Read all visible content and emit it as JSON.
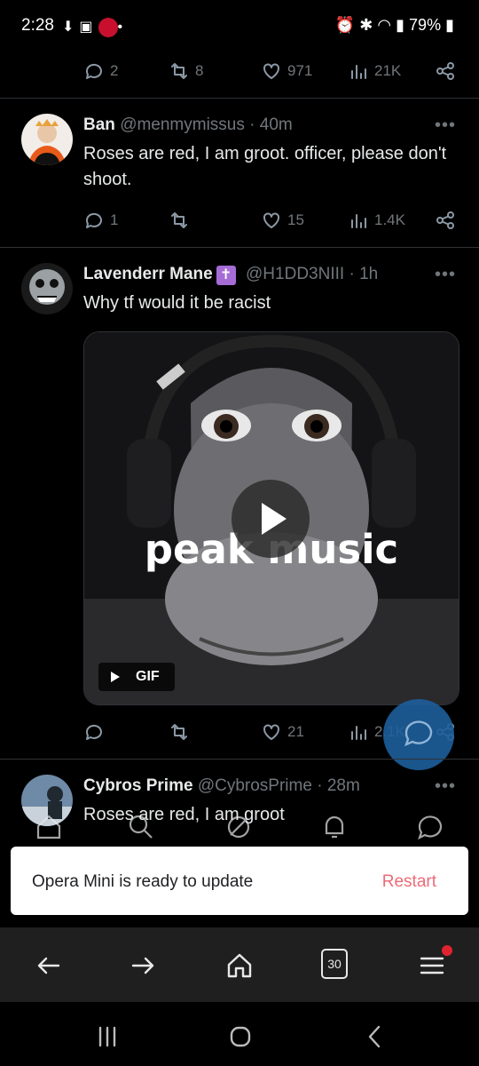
{
  "status_bar": {
    "time": "2:28",
    "battery": "79%"
  },
  "tweet0": {
    "replies": "2",
    "retweets": "8",
    "likes": "971",
    "views": "21K"
  },
  "tweet1": {
    "name": "Ban",
    "handle": "@menmymissus",
    "time": "40m",
    "text": "Roses are red, I am groot. officer, please don't shoot.",
    "replies": "1",
    "retweets": "",
    "likes": "15",
    "views": "1.4K"
  },
  "tweet2": {
    "name": "Lavenderr Mane",
    "badge": "✝",
    "handle": "@H1DD3NIII",
    "time": "1h",
    "text": "Why tf would it be racist",
    "media_caption": "peak music",
    "media_label": "GIF",
    "replies": "",
    "retweets": "",
    "likes": "21",
    "views": "2.1K"
  },
  "tweet3": {
    "name": "Cybros Prime",
    "handle": "@CybrosPrime",
    "time": "28m",
    "text": "Roses are red, I am groot"
  },
  "toast": {
    "message": "Opera Mini is ready to update",
    "action": "Restart"
  },
  "opera_bar": {
    "tab_count": "30"
  },
  "colors": {
    "accent": "#1d9bf0",
    "restart": "#ec6b78",
    "background": "#000000"
  }
}
